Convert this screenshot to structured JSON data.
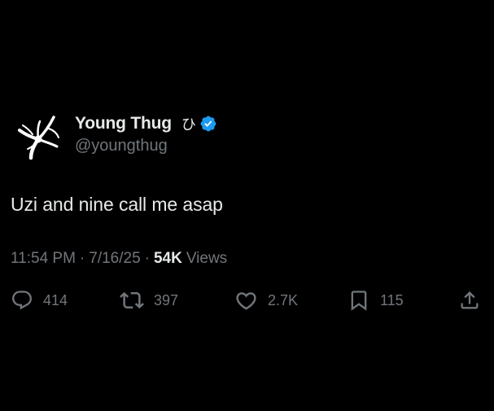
{
  "user": {
    "display_name": "Young Thug",
    "name_suffix": "ひ",
    "handle": "@youngthug",
    "verified": true,
    "verified_color": "#1d9bf0",
    "avatar_icon": "splash-logo-icon"
  },
  "tweet": {
    "text": "Uzi and nine call me asap",
    "time": "11:54 PM",
    "date": "7/16/25",
    "views_count": "54K",
    "views_label": "Views"
  },
  "actions": {
    "replies": "414",
    "reposts": "397",
    "likes": "2.7K",
    "bookmarks": "115"
  },
  "colors": {
    "background": "#000000",
    "primary_text": "#e7e9ea",
    "secondary_text": "#71767b"
  }
}
